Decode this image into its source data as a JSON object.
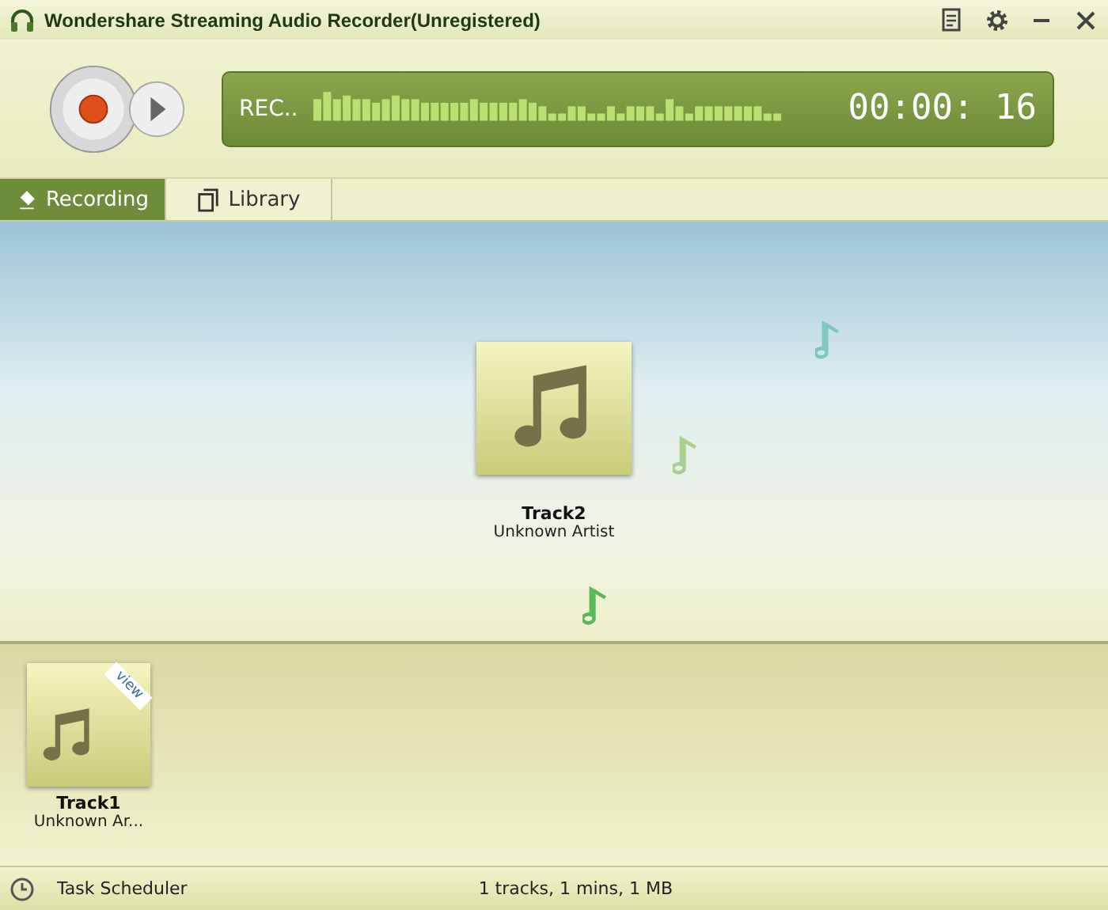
{
  "window": {
    "title": "Wondershare Streaming Audio Recorder(Unregistered)"
  },
  "display": {
    "status": "REC..",
    "time": "00:00: 16"
  },
  "tabs": [
    {
      "label": "Recording",
      "selected": true
    },
    {
      "label": "Library",
      "selected": false
    }
  ],
  "current_track": {
    "title": "Track2",
    "artist": "Unknown Artist"
  },
  "tray": [
    {
      "title": "Track1",
      "artist": "Unknown Ar...",
      "ribbon": "view"
    }
  ],
  "status_bar": {
    "scheduler": "Task Scheduler",
    "summary": "1 tracks, 1 mins, 1 MB"
  }
}
